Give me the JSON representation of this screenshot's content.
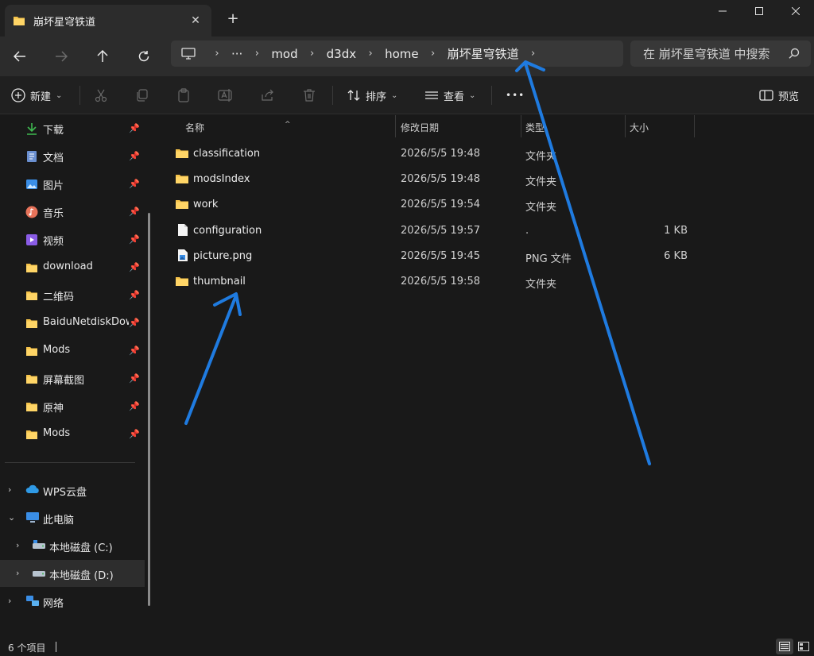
{
  "window": {
    "tab_title": "崩坏星穹铁道",
    "close_tab": "✕",
    "new_tab": "+"
  },
  "address": {
    "more": "···",
    "crumbs": [
      "mod",
      "d3dx",
      "home",
      "崩坏星穹铁道"
    ]
  },
  "search": {
    "placeholder": "在 崩坏星穹铁道 中搜索"
  },
  "toolbar": {
    "new_label": "新建",
    "sort_label": "排序",
    "view_label": "查看",
    "more": "•••",
    "preview_label": "预览"
  },
  "sidebar": {
    "quick_access": [
      {
        "label": "下载",
        "icon": "download-icon",
        "color": "#3fb950"
      },
      {
        "label": "文档",
        "icon": "document-icon",
        "color": "#6a8fd0"
      },
      {
        "label": "图片",
        "icon": "pictures-icon",
        "color": "#3a8ee6"
      },
      {
        "label": "音乐",
        "icon": "music-icon",
        "color": "#e8735a"
      },
      {
        "label": "视频",
        "icon": "video-icon",
        "color": "#8a5ce6"
      },
      {
        "label": "download",
        "icon": "folder-icon",
        "color": "#f5c249"
      },
      {
        "label": "二维码",
        "icon": "folder-icon",
        "color": "#f5c249"
      },
      {
        "label": "BaiduNetdiskDownload",
        "icon": "folder-icon",
        "color": "#f5c249"
      },
      {
        "label": "Mods",
        "icon": "folder-icon",
        "color": "#f5c249"
      },
      {
        "label": "屏幕截图",
        "icon": "folder-icon",
        "color": "#f5c249"
      },
      {
        "label": "原神",
        "icon": "folder-icon",
        "color": "#f5c249"
      },
      {
        "label": "Mods",
        "icon": "folder-icon",
        "color": "#f5c249"
      }
    ],
    "tree": [
      {
        "label": "WPS云盘",
        "icon": "cloud-icon"
      },
      {
        "label": "此电脑",
        "icon": "computer-icon"
      },
      {
        "label": "本地磁盘 (C:)",
        "icon": "drive-icon"
      },
      {
        "label": "本地磁盘 (D:)",
        "icon": "drive-icon"
      },
      {
        "label": "网络",
        "icon": "network-icon"
      }
    ]
  },
  "columns": {
    "name": "名称",
    "modified": "修改日期",
    "type": "类型",
    "size": "大小"
  },
  "files": [
    {
      "name": "classification",
      "modified": "2026/5/5 19:48",
      "type": "文件夹",
      "size": "",
      "icon": "folder-icon"
    },
    {
      "name": "modsIndex",
      "modified": "2026/5/5 19:48",
      "type": "文件夹",
      "size": "",
      "icon": "folder-icon"
    },
    {
      "name": "work",
      "modified": "2026/5/5 19:54",
      "type": "文件夹",
      "size": "",
      "icon": "folder-icon"
    },
    {
      "name": "configuration",
      "modified": "2026/5/5 19:57",
      "type": ".",
      "size": "1 KB",
      "icon": "file-icon"
    },
    {
      "name": "picture.png",
      "modified": "2026/5/5 19:45",
      "type": "PNG 文件",
      "size": "6 KB",
      "icon": "image-file-icon"
    },
    {
      "name": "thumbnail",
      "modified": "2026/5/5 19:58",
      "type": "文件夹",
      "size": "",
      "icon": "folder-icon"
    }
  ],
  "status": {
    "item_count": "6 个项目"
  },
  "colors": {
    "annotation_arrow": "#1f7be0",
    "folder": "#f5c249"
  }
}
